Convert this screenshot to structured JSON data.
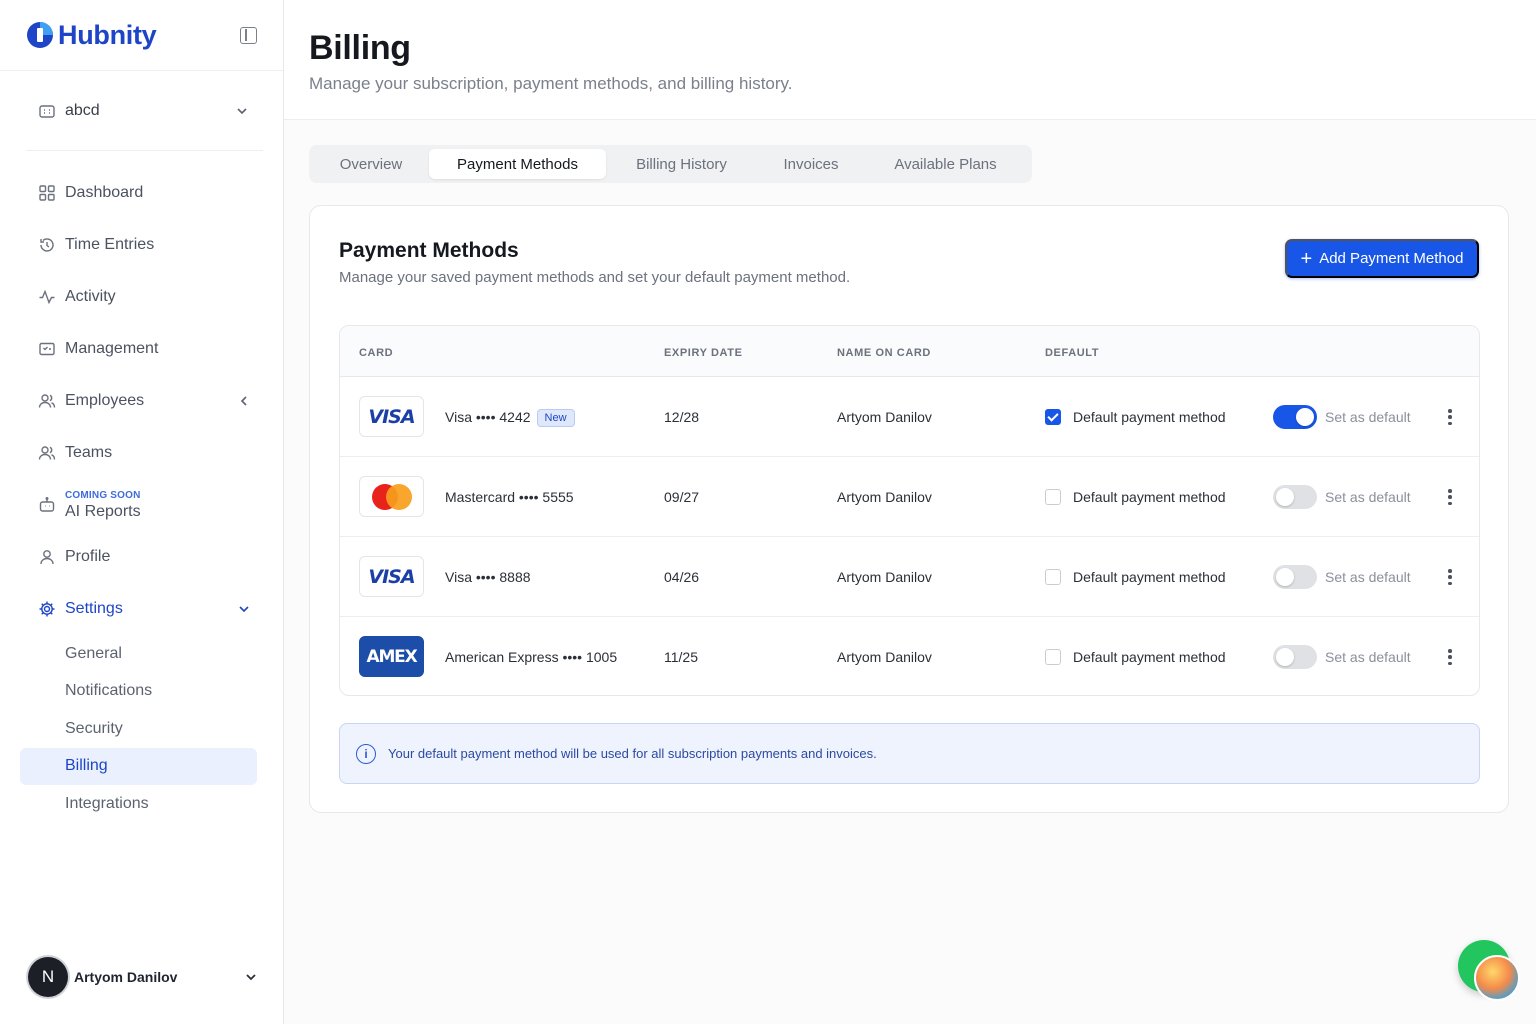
{
  "brand": {
    "name": "Hubnity",
    "color": "#1e45c7"
  },
  "org": {
    "name": "abcd"
  },
  "nav": {
    "items": [
      {
        "label": "Dashboard",
        "icon": "grid-icon"
      },
      {
        "label": "Time Entries",
        "icon": "history-icon"
      },
      {
        "label": "Activity",
        "icon": "activity-icon"
      },
      {
        "label": "Management",
        "icon": "folder-icon"
      },
      {
        "label": "Employees",
        "icon": "users-icon"
      },
      {
        "label": "Teams",
        "icon": "users-icon"
      },
      {
        "label": "AI Reports",
        "icon": "bot-icon",
        "tag": "COMING SOON"
      },
      {
        "label": "Profile",
        "icon": "user-icon"
      },
      {
        "label": "Settings",
        "icon": "gear-icon"
      }
    ],
    "settings_sub": [
      "General",
      "Notifications",
      "Security",
      "Billing",
      "Integrations"
    ],
    "active_sub": "Billing"
  },
  "user": {
    "initial": "N",
    "name": "Artyom Danilov"
  },
  "page": {
    "title": "Billing",
    "subtitle": "Manage your subscription, payment methods, and billing history."
  },
  "tabs": [
    "Overview",
    "Payment Methods",
    "Billing History",
    "Invoices",
    "Available Plans"
  ],
  "active_tab": "Payment Methods",
  "section": {
    "title": "Payment Methods",
    "subtitle": "Manage your saved payment methods and set your default payment method.",
    "add_button": "Add Payment Method"
  },
  "table": {
    "headers": [
      "CARD",
      "EXPIRY DATE",
      "NAME ON CARD",
      "DEFAULT"
    ],
    "rows": [
      {
        "brand_logo": "VISA",
        "card": "Visa •••• 4242",
        "badge": "New",
        "expiry": "12/28",
        "name": "Artyom Danilov",
        "default_label": "Default payment method",
        "is_default": true,
        "toggle_label": "Set as default"
      },
      {
        "brand_logo": "mastercard",
        "card": "Mastercard •••• 5555",
        "badge": "",
        "expiry": "09/27",
        "name": "Artyom Danilov",
        "default_label": "Default payment method",
        "is_default": false,
        "toggle_label": "Set as default"
      },
      {
        "brand_logo": "VISA",
        "card": "Visa •••• 8888",
        "badge": "",
        "expiry": "04/26",
        "name": "Artyom Danilov",
        "default_label": "Default payment method",
        "is_default": false,
        "toggle_label": "Set as default"
      },
      {
        "brand_logo": "AMEX",
        "card": "American Express •••• 1005",
        "badge": "",
        "expiry": "11/25",
        "name": "Artyom Danilov",
        "default_label": "Default payment method",
        "is_default": false,
        "toggle_label": "Set as default"
      }
    ]
  },
  "info": {
    "text": "Your default payment method will be used for all subscription payments and invoices."
  },
  "colors": {
    "accent": "#1856e8",
    "info_bg": "#eef3fd",
    "active_bg": "#eaf0fd"
  }
}
